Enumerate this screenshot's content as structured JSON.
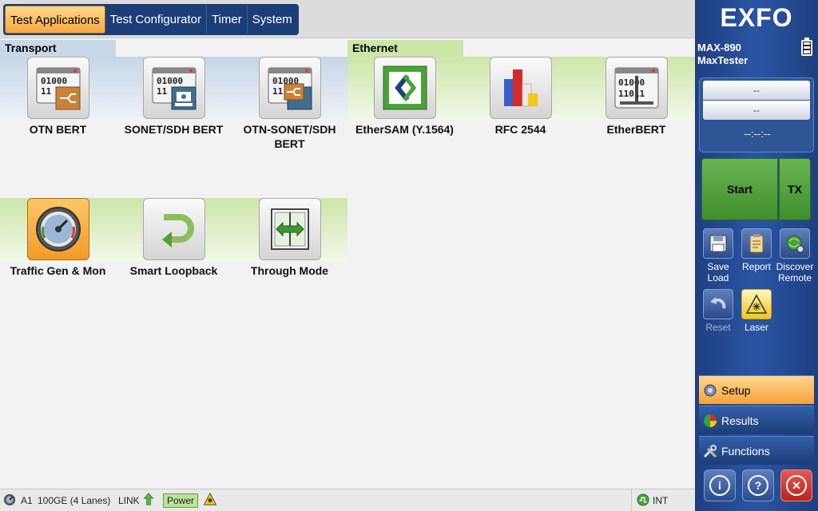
{
  "tabs": [
    "Test Applications",
    "Test Configurator",
    "Timer",
    "System"
  ],
  "sections": {
    "transport": "Transport",
    "ethernet": "Ethernet"
  },
  "apps": {
    "otn_bert": "OTN BERT",
    "sonet_sdh_bert": "SONET/SDH BERT",
    "otn_sonet_sdh_bert": "OTN-SONET/SDH BERT",
    "ethersam": "EtherSAM (Y.1564)",
    "rfc2544": "RFC 2544",
    "etherbert": "EtherBERT",
    "traffic_gen": "Traffic Gen & Mon",
    "smart_loopback": "Smart Loopback",
    "through_mode": "Through Mode"
  },
  "sidebar": {
    "logo": "EXFO",
    "model_line1": "MAX-890",
    "model_line2": "MaxTester",
    "status_row1": "--",
    "status_row2": "--",
    "status_time": "--:--:--",
    "start": "Start",
    "tx": "TX",
    "tools": {
      "save_load_1": "Save",
      "save_load_2": "Load",
      "report": "Report",
      "discover_1": "Discover",
      "discover_2": "Remote",
      "reset": "Reset",
      "laser": "Laser"
    },
    "nav": {
      "setup": "Setup",
      "results": "Results",
      "functions": "Functions"
    }
  },
  "statusbar": {
    "port": "A1",
    "rate": "100GE (4 Lanes)",
    "link": "LINK",
    "power": "Power",
    "clock": "INT"
  },
  "colors": {
    "brand_blue": "#1f3f80",
    "active_orange": "#f5a742",
    "start_green": "#4f9e3b"
  }
}
